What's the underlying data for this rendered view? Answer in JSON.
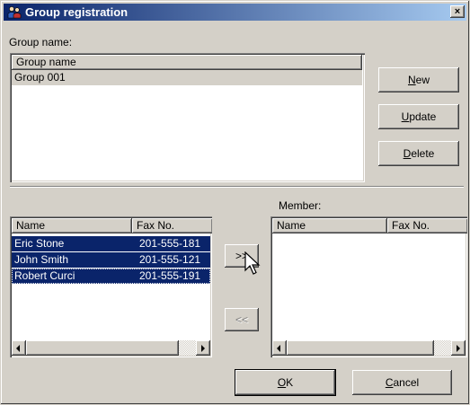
{
  "window": {
    "title": "Group registration",
    "close_label": "×"
  },
  "group_name_label": "Group name:",
  "groups": {
    "header": "Group name",
    "rows": [
      "Group 001"
    ]
  },
  "buttons": {
    "new_label": "New",
    "update_label": "Update",
    "delete_label": "Delete",
    "add_label": ">>",
    "remove_label": "<<",
    "ok_label": "OK",
    "cancel_label": "Cancel"
  },
  "member_label": "Member:",
  "contacts": {
    "headers": {
      "name": "Name",
      "fax": "Fax No."
    },
    "rows": [
      {
        "name": "Eric Stone",
        "fax": "201-555-181"
      },
      {
        "name": "John Smith",
        "fax": "201-555-121"
      },
      {
        "name": "Robert Curci",
        "fax": "201-555-191"
      }
    ]
  },
  "members": {
    "headers": {
      "name": "Name",
      "fax": "Fax No."
    },
    "rows": []
  },
  "icons": {
    "title": "people-icon",
    "cursor": "mouse-pointer-icon",
    "scroll_left": "scroll-left-arrow-icon",
    "scroll_right": "scroll-right-arrow-icon"
  },
  "colors": {
    "title_bar": "#0a246a",
    "selection": "#0a246a",
    "face": "#d4d0c8"
  }
}
